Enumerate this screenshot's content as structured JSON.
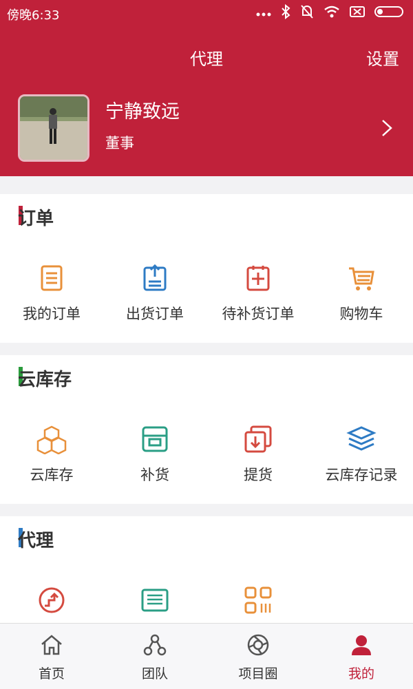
{
  "status": {
    "time": "傍晚6:33"
  },
  "header": {
    "title": "代理",
    "settings": "设置"
  },
  "profile": {
    "name": "宁静致远",
    "role": "董事"
  },
  "colors": {
    "brand": "#c0213a",
    "orange": "#e8903a",
    "blue": "#2e7bc4",
    "teal": "#2a9e85",
    "red": "#d44a3f",
    "green": "#2a9b3c"
  },
  "sections": {
    "orders": {
      "title": "订单",
      "items": [
        {
          "label": "我的订单",
          "icon": "list-icon"
        },
        {
          "label": "出货订单",
          "icon": "ship-out-icon"
        },
        {
          "label": "待补货订单",
          "icon": "restock-icon"
        },
        {
          "label": "购物车",
          "icon": "cart-icon"
        }
      ]
    },
    "cloud": {
      "title": "云库存",
      "items": [
        {
          "label": "云库存",
          "icon": "boxes-icon"
        },
        {
          "label": "补货",
          "icon": "replenish-icon"
        },
        {
          "label": "提货",
          "icon": "pickup-icon"
        },
        {
          "label": "云库存记录",
          "icon": "layers-icon"
        }
      ]
    },
    "agent": {
      "title": "代理",
      "items": [
        {
          "label": "",
          "icon": "upgrade-icon"
        },
        {
          "label": "",
          "icon": "authorization-icon"
        },
        {
          "label": "",
          "icon": "qr-icon"
        }
      ]
    }
  },
  "tabs": [
    {
      "label": "首页",
      "icon": "home-icon"
    },
    {
      "label": "团队",
      "icon": "team-icon"
    },
    {
      "label": "项目圈",
      "icon": "circle-icon"
    },
    {
      "label": "我的",
      "icon": "user-icon",
      "active": true
    }
  ]
}
